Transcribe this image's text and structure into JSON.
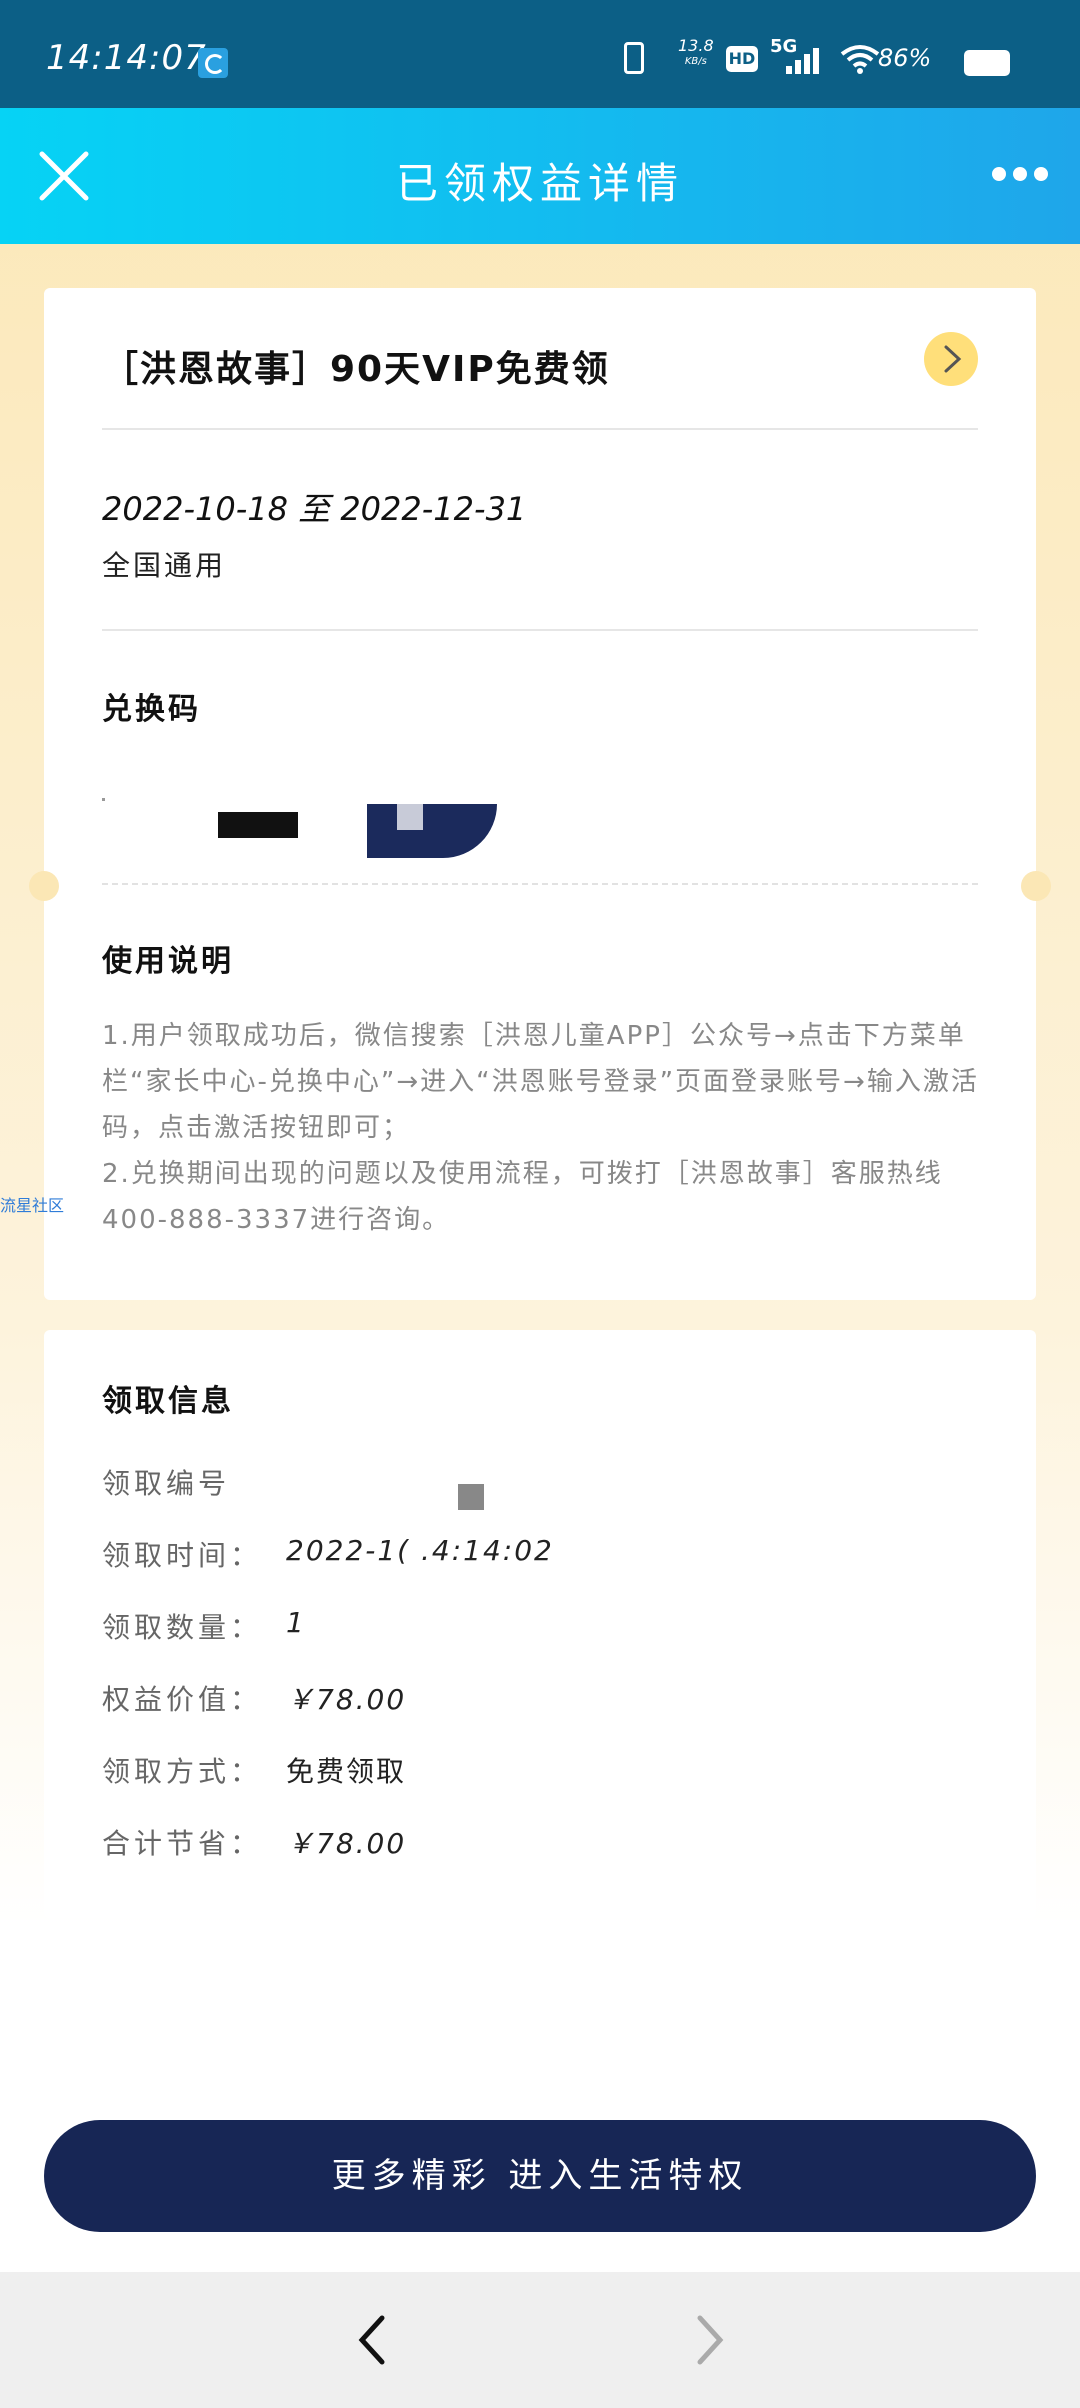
{
  "status_bar": {
    "time": "14:14:07",
    "net_speed_value": "13.8",
    "net_speed_unit": "KB/s",
    "hd": "HD",
    "network": "5G",
    "battery": "86%"
  },
  "header": {
    "title": "已领权益详情"
  },
  "benefit": {
    "title": "［洪恩故事］90天VIP免费领",
    "period": "2022-10-18  至  2022-12-31",
    "scope": "全国通用"
  },
  "redeem": {
    "heading": "兑换码"
  },
  "usage": {
    "heading": "使用说明",
    "line1": "1.用户领取成功后，微信搜索［洪恩儿童APP］公众号→点击下方菜单栏“家长中心-兑换中心”→进入“洪恩账号登录”页面登录账号→输入激活码，点击激活按钮即可；",
    "line2": "2.兑换期间出现的问题以及使用流程，可拨打［洪恩故事］客服热线400-888-3337进行咨询。"
  },
  "side_label": "流星社区",
  "claim_info": {
    "heading": "领取信息",
    "rows": [
      {
        "label": "领取编号",
        "value": ""
      },
      {
        "label": "领取时间：",
        "value": "2022-1(      .4:14:02"
      },
      {
        "label": "领取数量：",
        "value": "1"
      },
      {
        "label": "权益价值：",
        "value": "￥78.00"
      },
      {
        "label": "领取方式：",
        "value": "免费领取"
      },
      {
        "label": "合计节省：",
        "value": "￥78.00"
      }
    ]
  },
  "cta": {
    "label": "更多精彩 进入生活特权"
  },
  "colors": {
    "header_start": "#06d3f5",
    "header_end": "#1fa6ea",
    "cta_bg": "#172655",
    "arrow_bg": "#ffdf7a",
    "status_bg": "#0c5f86"
  },
  "icons": {
    "close": "close-icon",
    "more": "more-dots-icon",
    "arrow": "chevron-right-icon",
    "back": "chevron-left-icon",
    "forward": "chevron-right-icon"
  }
}
